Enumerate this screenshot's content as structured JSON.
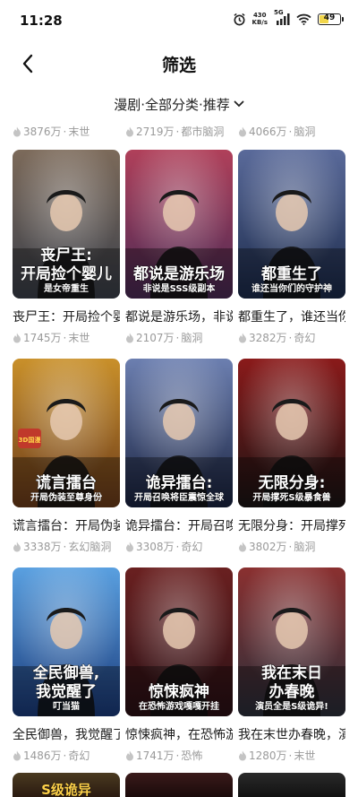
{
  "status": {
    "time": "11:28",
    "net_speed_value": "430",
    "net_speed_unit": "KB/s",
    "signal_label": "5G",
    "battery": "49"
  },
  "header": {
    "title": "筛选"
  },
  "filter": {
    "label": "漫剧·全部分类·推荐"
  },
  "top_metas": [
    {
      "views": "3876万",
      "genre": "末世"
    },
    {
      "views": "2719万",
      "genre": "都市脑洞"
    },
    {
      "views": "4066万",
      "genre": "脑洞"
    }
  ],
  "cards": [
    {
      "title": "丧尸王：开局捡个婴儿是女帝重生",
      "views": "1745万",
      "genre": "末世",
      "cover_text_1": "丧尸王:",
      "cover_text_2": "开局捡个婴儿",
      "cover_text_3": "是女帝重生",
      "bg1": "#3a3f4a",
      "bg2": "#7c6a5a"
    },
    {
      "title": "都说是游乐场，非说是SSS级副本",
      "views": "2107万",
      "genre": "脑洞",
      "cover_text_1": "都说是游乐场",
      "cover_text_2": "非说是SSS级副本",
      "bg1": "#4a2a55",
      "bg2": "#b0405a"
    },
    {
      "title": "都重生了，谁还当你们的守护神",
      "views": "3282万",
      "genre": "奇幻",
      "cover_text_1": "都重生了",
      "cover_text_2": "谁还当你们的守护神",
      "bg1": "#1b2a4a",
      "bg2": "#5a6a9a"
    },
    {
      "title": "谎言擂台：开局伪装至尊身份",
      "views": "3338万",
      "genre": "玄幻脑洞",
      "cover_text_1": "谎言擂台",
      "cover_text_2": "开局伪装至尊身份",
      "cover_badge": "3D国漫",
      "bg1": "#6a3a1a",
      "bg2": "#c9902a"
    },
    {
      "title": "诡异擂台：开局召唤将臣震惊全球",
      "views": "3308万",
      "genre": "奇幻",
      "cover_text_1": "诡异擂台:",
      "cover_text_2": "开局召唤将臣震惊全球",
      "bg1": "#1a2340",
      "bg2": "#6c7fb0"
    },
    {
      "title": "无限分身：开局撑死S级暴食兽",
      "views": "3802万",
      "genre": "脑洞",
      "cover_text_1": "无限分身:",
      "cover_text_2": "开局撑死S级暴食兽",
      "bg1": "#1a1414",
      "bg2": "#8a1a1a"
    },
    {
      "title": "全民御兽，我觉醒了叮当猫",
      "views": "1486万",
      "genre": "奇幻",
      "cover_text_1": "全民御兽,",
      "cover_text_2": "我觉醒了",
      "cover_text_3": "叮当猫",
      "bg1": "#1a3a7a",
      "bg2": "#5aa0e0"
    },
    {
      "title": "惊悚疯神，在恐怖游戏嘎嘎开挂",
      "views": "1741万",
      "genre": "恐怖",
      "cover_text_1": "惊悚疯神",
      "cover_text_2": "在恐怖游戏嘎嘎开挂",
      "bg1": "#2a1015",
      "bg2": "#6a2020"
    },
    {
      "title": "我在末世办春晚，演员全是S级诡异",
      "views": "1280万",
      "genre": "末世",
      "cover_text_1": "我在末日",
      "cover_text_2": "办春晚",
      "cover_text_3": "演员全是S级诡异!",
      "bg1": "#2a2f3a",
      "bg2": "#8a3030"
    }
  ],
  "bottom_partial": [
    {
      "cover_text": "S级诡异",
      "bg1": "#4a3a20",
      "bg2": "#2a1a10"
    },
    {
      "cover_text": "",
      "bg1": "#3a1a1a",
      "bg2": "#1a0a0a"
    },
    {
      "cover_text": "",
      "bg1": "#2a2a2a",
      "bg2": "#111111"
    }
  ],
  "colors": {
    "meta_gray": "#9a9a9a",
    "title_black": "#1a1a1a",
    "battery_yellow": "#f2d64b"
  },
  "icons": {
    "back": "chevron-left-icon",
    "dropdown": "chevron-down-icon",
    "heat": "flame-icon",
    "alarm": "alarm-icon",
    "wifi": "wifi-icon",
    "signal": "signal-icon",
    "battery": "battery-icon"
  }
}
